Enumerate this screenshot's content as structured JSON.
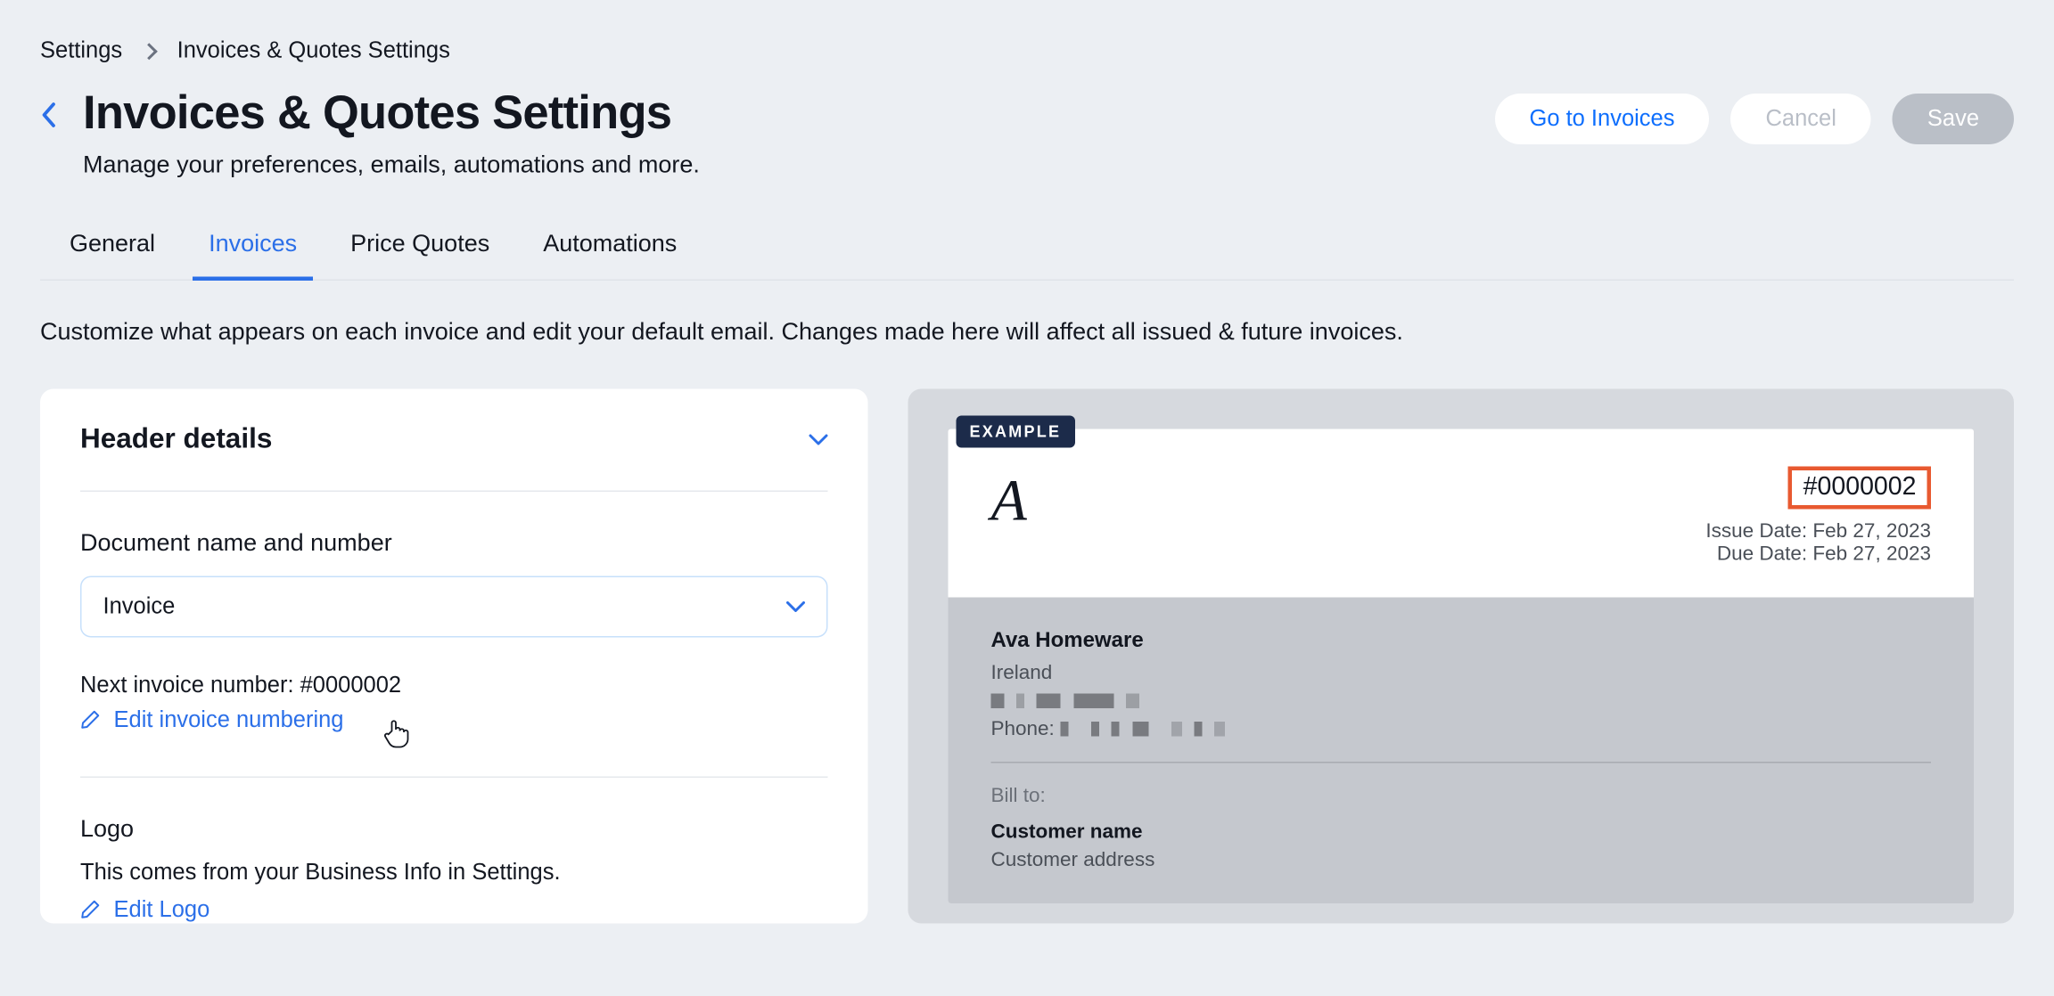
{
  "breadcrumb": {
    "root": "Settings",
    "current": "Invoices & Quotes Settings"
  },
  "header": {
    "title": "Invoices & Quotes Settings",
    "subtitle": "Manage your preferences, emails, automations and more.",
    "go_to_invoices": "Go to Invoices",
    "cancel": "Cancel",
    "save": "Save"
  },
  "tabs": {
    "general": "General",
    "invoices": "Invoices",
    "price_quotes": "Price Quotes",
    "automations": "Automations"
  },
  "description": "Customize what appears on each invoice and edit your default email. Changes made here will affect all issued & future invoices.",
  "card": {
    "title": "Header details",
    "doc_label": "Document name and number",
    "doc_type": "Invoice",
    "next_number_label": "Next invoice number: ",
    "next_number_value": "#0000002",
    "edit_numbering": "Edit invoice numbering",
    "logo_title": "Logo",
    "logo_desc": "This comes from your Business Info in Settings.",
    "edit_logo": "Edit Logo"
  },
  "preview": {
    "example": "EXAMPLE",
    "logo_text": "A",
    "invoice_number": "#0000002",
    "issue_date": "Issue Date: Feb 27, 2023",
    "due_date": "Due Date: Feb 27, 2023",
    "business_name": "Ava Homeware",
    "country": "Ireland",
    "phone_label": "Phone: ",
    "bill_to": "Bill to:",
    "customer_name": "Customer name",
    "customer_address": "Customer address"
  }
}
